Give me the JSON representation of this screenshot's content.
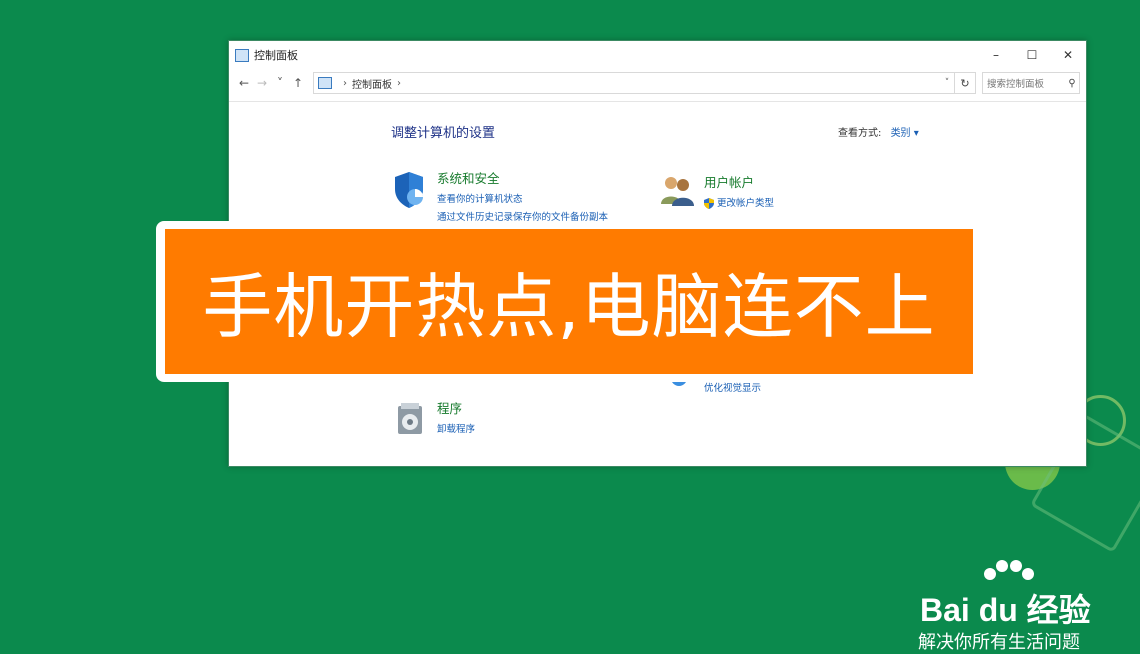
{
  "window": {
    "title": "控制面板",
    "buttons": {
      "minimize": "–",
      "maximize": "☐",
      "close": "✕"
    }
  },
  "address": {
    "back": "←",
    "forward": "→",
    "history": "˅",
    "up": "↑",
    "path_item": "控制面板",
    "separator": "›",
    "dropdown": "˅",
    "refresh": "↻",
    "search_placeholder": "搜索控制面板",
    "search_glyph": "⚲"
  },
  "content": {
    "page_title": "调整计算机的设置",
    "view_by_label": "查看方式:",
    "view_by_value": "类别 ▾",
    "categories": [
      {
        "title": "系统和安全",
        "links": [
          "查看你的计算机状态",
          "通过文件历史记录保存你的文件备份副本"
        ]
      },
      {
        "title": "用户帐户",
        "links": [
          "更改帐户类型"
        ]
      },
      {
        "title": "程序",
        "links": [
          "卸载程序"
        ]
      }
    ],
    "partial_link": "优化视觉显示"
  },
  "banner": {
    "text": "手机开热点,电脑连不上"
  },
  "logo": {
    "brand": "Bai du 经验",
    "slogan": "解决你所有生活问题"
  },
  "colors": {
    "background": "#0b8a4d",
    "banner": "#ff7b00",
    "link": "#1a5fb4",
    "category": "#167a2c"
  }
}
